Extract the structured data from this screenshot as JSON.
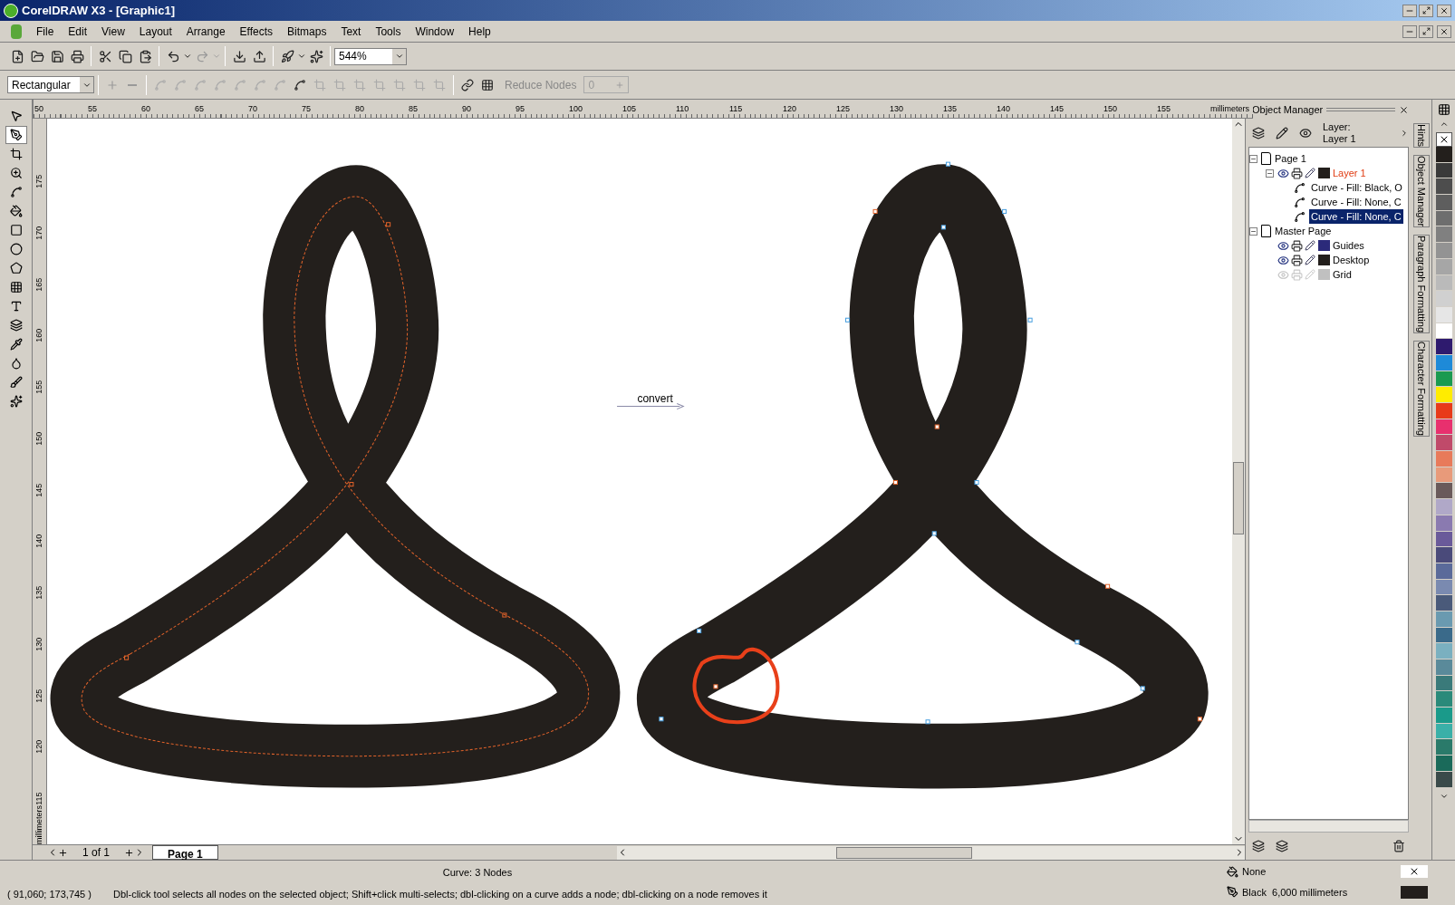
{
  "window": {
    "title": "CorelDRAW X3 - [Graphic1]"
  },
  "menu": [
    {
      "label": "File"
    },
    {
      "label": "Edit"
    },
    {
      "label": "View"
    },
    {
      "label": "Layout"
    },
    {
      "label": "Arrange"
    },
    {
      "label": "Effects"
    },
    {
      "label": "Bitmaps"
    },
    {
      "label": "Text"
    },
    {
      "label": "Tools"
    },
    {
      "label": "Window"
    },
    {
      "label": "Help"
    }
  ],
  "toolbar": {
    "zoom": "544%"
  },
  "property_bar": {
    "selection_mode": "Rectangular",
    "reduce_nodes": "Reduce Nodes",
    "smoothness": "0"
  },
  "ruler_h": {
    "labels": [
      "50",
      "55",
      "60",
      "65",
      "70",
      "75",
      "80",
      "85",
      "90",
      "95",
      "100",
      "105",
      "110",
      "115",
      "120",
      "125",
      "130",
      "135",
      "140",
      "145",
      "150",
      "155"
    ],
    "unit": "millimeters"
  },
  "ruler_v": {
    "labels": [
      "175",
      "170",
      "165",
      "160",
      "155",
      "150",
      "145",
      "140",
      "135",
      "130",
      "125",
      "120",
      "115"
    ],
    "unit": "millimeters"
  },
  "canvas": {
    "annotation": "convert"
  },
  "page_nav": {
    "counter": "1 of 1",
    "tabs": [
      {
        "label": "Page 1",
        "selected": true
      }
    ]
  },
  "object_manager": {
    "title": "Object Manager",
    "layer_caption": "Layer:",
    "layer_name": "Layer 1",
    "tree": [
      {
        "label": "Page 1",
        "kind": "page",
        "expanded": true,
        "children": [
          {
            "label": "Layer 1",
            "kind": "layer",
            "visible": true,
            "active": true,
            "color": "#231f1c",
            "expanded": true,
            "children": [
              {
                "label": "Curve - Fill: Black, O",
                "kind": "curve",
                "selected": false
              },
              {
                "label": "Curve - Fill: None, C",
                "kind": "curve",
                "selected": false
              },
              {
                "label": "Curve - Fill: None, C",
                "kind": "curve",
                "selected": true
              }
            ]
          }
        ]
      },
      {
        "label": "Master Page",
        "kind": "page",
        "expanded": true,
        "children": [
          {
            "label": "Guides",
            "kind": "layer",
            "visible": true,
            "active": false,
            "color": "#2b2a7a"
          },
          {
            "label": "Desktop",
            "kind": "layer",
            "visible": true,
            "active": false,
            "color": "#231f1c"
          },
          {
            "label": "Grid",
            "kind": "layer",
            "visible": false,
            "active": false,
            "color": "#c0c0c0"
          }
        ]
      }
    ]
  },
  "docker_tabs": [
    {
      "label": "Hints"
    },
    {
      "label": "Object Manager"
    },
    {
      "label": "Paragraph Formatting"
    },
    {
      "label": "Character Formatting"
    }
  ],
  "palette": [
    {
      "color": "#231f1c"
    },
    {
      "color": "#3a3a3a"
    },
    {
      "color": "#4d4d4d"
    },
    {
      "color": "#5e5e5e"
    },
    {
      "color": "#6e6e6e"
    },
    {
      "color": "#808080"
    },
    {
      "color": "#939393"
    },
    {
      "color": "#a6a6a6"
    },
    {
      "color": "#bababa"
    },
    {
      "color": "#d0d0d0"
    },
    {
      "color": "#e6e6e6"
    },
    {
      "color": "#ffffff"
    },
    {
      "color": "#2e1a6e"
    },
    {
      "color": "#1e8ad8"
    },
    {
      "color": "#1a9a50"
    },
    {
      "color": "#ffec00"
    },
    {
      "color": "#e83a1a"
    },
    {
      "color": "#e8306e"
    },
    {
      "color": "#c04a6a"
    },
    {
      "color": "#e87a5a"
    },
    {
      "color": "#e89a7a"
    },
    {
      "color": "#6a5a5a"
    },
    {
      "color": "#b0a8c8"
    },
    {
      "color": "#8a7ab0"
    },
    {
      "color": "#6a5a9a"
    },
    {
      "color": "#4a4a7a"
    },
    {
      "color": "#5a6a9a"
    },
    {
      "color": "#7a8ab0"
    },
    {
      "color": "#4a5a7a"
    },
    {
      "color": "#6a9ab0"
    },
    {
      "color": "#3a6a8a"
    },
    {
      "color": "#7ab0c0"
    },
    {
      "color": "#5a8a9a"
    },
    {
      "color": "#3a7a7a"
    },
    {
      "color": "#2a8a7a"
    },
    {
      "color": "#1a9a8a"
    },
    {
      "color": "#3ab0a8"
    },
    {
      "color": "#2a7a6a"
    },
    {
      "color": "#1a6a5a"
    },
    {
      "color": "#3a4a4a"
    }
  ],
  "status": {
    "object_info": "Curve: 3 Nodes",
    "coordinates": "( 91,060; 173,745 )",
    "hint": "Dbl-click tool selects all nodes on the selected object; Shift+click multi-selects; dbl-clicking on a curve adds a node; dbl-clicking on a node removes it",
    "fill": "None",
    "outline": "Black  6,000 millimeters"
  }
}
